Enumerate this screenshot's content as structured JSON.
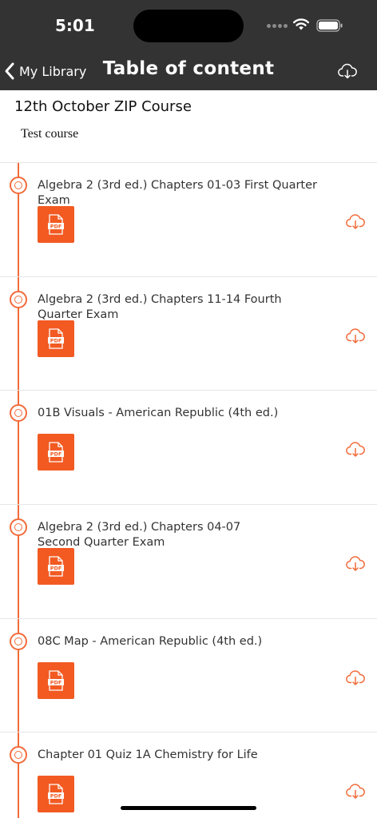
{
  "status_bar": {
    "time": "5:01"
  },
  "header": {
    "back_label": "My Library",
    "title": "Table of content"
  },
  "course": {
    "title": "12th October ZIP Course",
    "description": "Test course"
  },
  "items": [
    {
      "title": "Algebra 2 (3rd ed.) Chapters 01-03 First Quarter Exam",
      "file_type": "PDF"
    },
    {
      "title": "Algebra 2 (3rd ed.) Chapters 11-14 Fourth Quarter Exam",
      "file_type": "PDF"
    },
    {
      "title": "01B Visuals - American Republic (4th ed.)",
      "file_type": "PDF"
    },
    {
      "title": "Algebra 2 (3rd ed.) Chapters 04-07 Second Quarter Exam",
      "file_type": "PDF"
    },
    {
      "title": "08C Map - American Republic (4th ed.)",
      "file_type": "PDF"
    },
    {
      "title": "Chapter 01 Quiz 1A Chemistry for Life",
      "file_type": "PDF"
    }
  ],
  "icons": {
    "back": "chevron-left-icon",
    "download": "cloud-download-icon",
    "file": "pdf-file-icon",
    "timeline_marker": "circle-marker-icon"
  },
  "colors": {
    "header_bg": "#333333",
    "accent": "#f26b3a",
    "pdf_tile": "#f25a22"
  }
}
